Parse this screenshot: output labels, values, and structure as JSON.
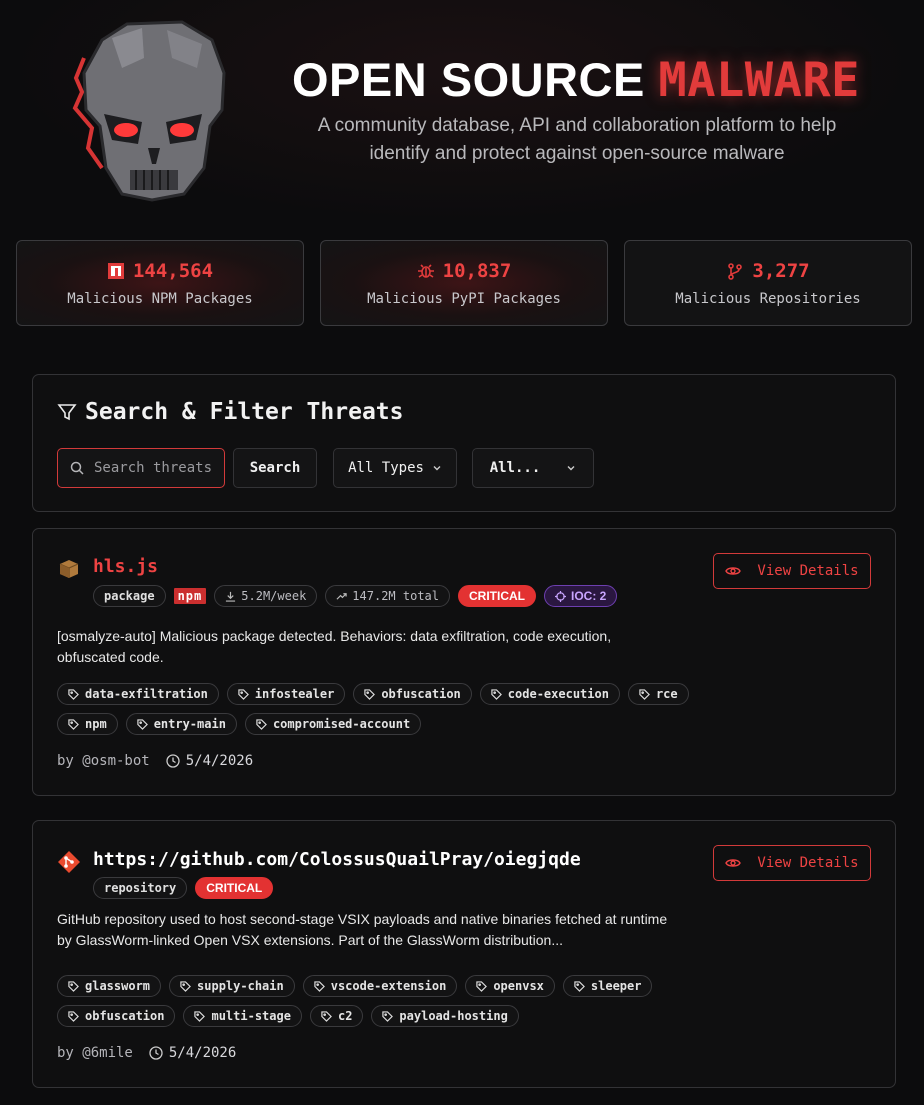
{
  "header": {
    "title_main": "OPEN SOURCE",
    "title_accent": "MALWARE",
    "subtitle": "A community database, API and collaboration platform to help identify and protect against open-source malware",
    "logo_icon": "skull-icon"
  },
  "stats": [
    {
      "value": "144,564",
      "label": "Malicious NPM Packages",
      "icon": "npm-icon"
    },
    {
      "value": "10,837",
      "label": "Malicious PyPI Packages",
      "icon": "bug-icon"
    },
    {
      "value": "3,277",
      "label": "Malicious Repositories",
      "icon": "git-branch-icon"
    }
  ],
  "search": {
    "title": "Search & Filter Threats",
    "placeholder": "Search threats...",
    "button_label": "Search",
    "type_select": "All Types",
    "second_select": "All..."
  },
  "threats": [
    {
      "name": "hls.js",
      "type": "package",
      "registry": "npm",
      "weekly": "5.2M/week",
      "total": "147.2M total",
      "severity": "CRITICAL",
      "ioc": "IOC: 2",
      "description": "[osmalyze-auto] Malicious package detected. Behaviors: data exfiltration, code execution, obfuscated code.",
      "tags": [
        "data-exfiltration",
        "infostealer",
        "obfuscation",
        "code-execution",
        "rce",
        "npm",
        "entry-main",
        "compromised-account"
      ],
      "author": "by @osm-bot",
      "date": "5/4/2026",
      "action": "View Details"
    },
    {
      "name": "https://github.com/ColossusQuailPray/oiegjqde",
      "type": "repository",
      "severity": "CRITICAL",
      "description": "GitHub repository used to host second-stage VSIX payloads and native binaries fetched at runtime by GlassWorm-linked Open VSX extensions. Part of the GlassWorm distribution...",
      "tags": [
        "glassworm",
        "supply-chain",
        "vscode-extension",
        "openvsx",
        "sleeper",
        "obfuscation",
        "multi-stage",
        "c2",
        "payload-hosting"
      ],
      "author": "by @6mile",
      "date": "5/4/2026",
      "action": "View Details"
    }
  ],
  "colors": {
    "accent": "#e23b3b",
    "background": "#0c0c0d",
    "ioc_purple": "#c9a5ff"
  }
}
